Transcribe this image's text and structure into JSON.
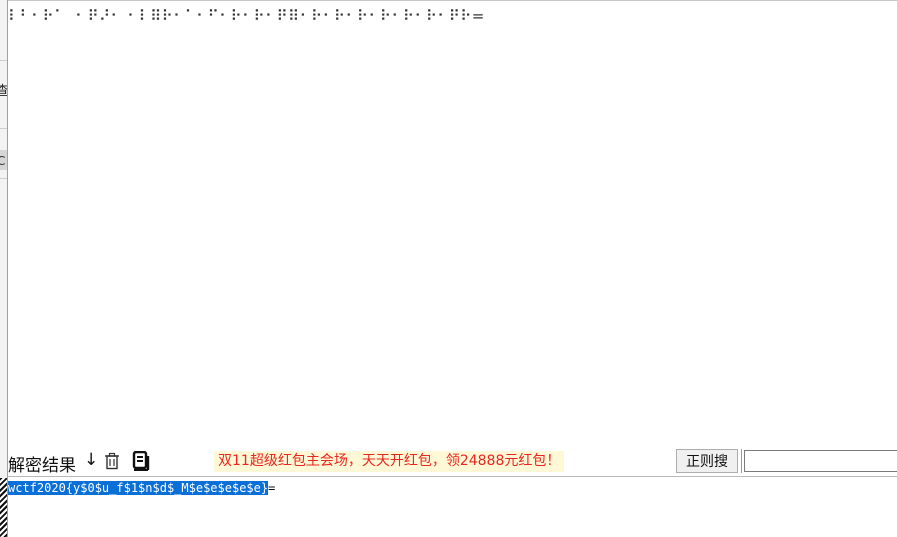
{
  "input": {
    "braille_text": "⠇⠃⠂⠗⠁ ⠐ ⠟⠜⠂ ⠂⠇⠿⠗⠂⠁⠂⠋⠂⠗⠂⠗⠂⠟⠿⠂⠗⠂⠗⠂⠗⠂⠗⠂⠗⠂⠗⠂⠟⠗="
  },
  "left_strip": {
    "fragment_char": "查",
    "fragment_char2": "C"
  },
  "toolbar": {
    "result_label": "解密结果",
    "down_arrow": "↓",
    "trash_icon": "trash-icon",
    "copy_icon": "copy-icon",
    "promo_text": "双11超级红包主会场，天天开红包，领24888元红包！",
    "regex_button_label": "正则搜",
    "regex_input_value": "",
    "promo_color": "#e8261f"
  },
  "output": {
    "selected_text": "wctf2020{y$0$u_f$1$n$d$_M$e$e$e$e$e}",
    "trailing_text": "="
  },
  "colors": {
    "selection": "#0a6fd6",
    "promo_bg": "#fff8d6"
  }
}
